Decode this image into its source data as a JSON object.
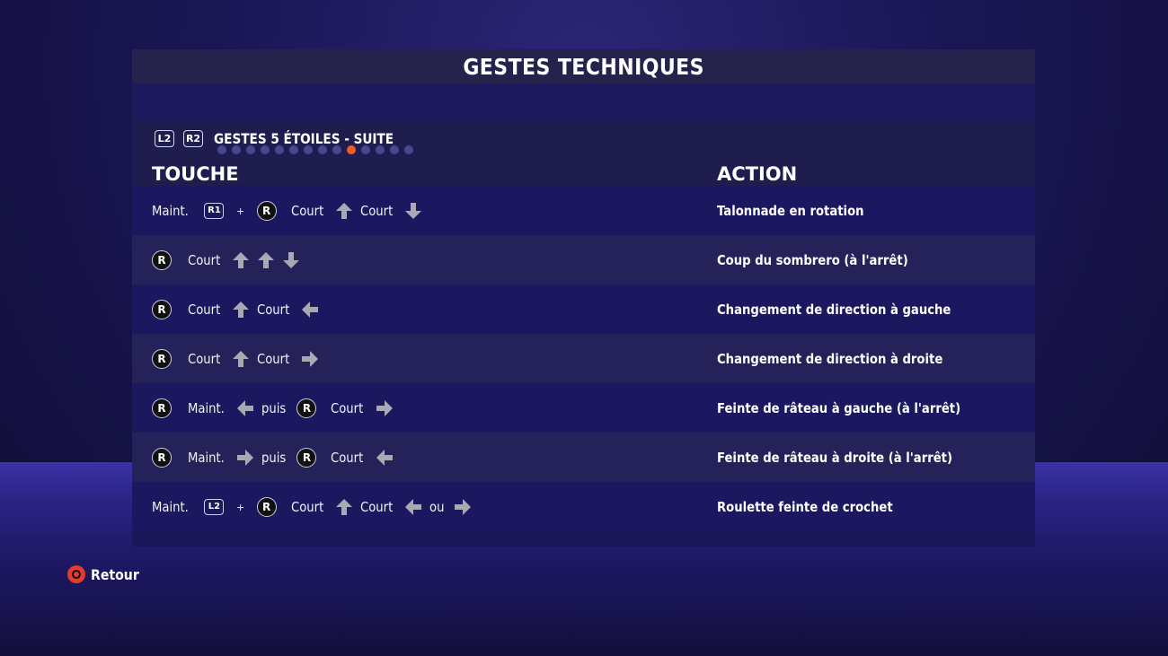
{
  "screen": {
    "title": "GESTES TECHNIQUES",
    "category": {
      "left_button": "L2",
      "right_button": "R2",
      "title": "GESTES 5 ÉTOILES - SUITE",
      "page_count": 14,
      "active_page": 10
    },
    "columns": {
      "touche": "TOUCHE",
      "action": "ACTION"
    },
    "rows": [
      {
        "sequence": [
          {
            "t": "word",
            "v": "Maint."
          },
          {
            "t": "key",
            "v": "R1"
          },
          {
            "t": "plus",
            "v": "+"
          },
          {
            "t": "stick",
            "v": "R"
          },
          {
            "t": "word",
            "v": "Court"
          },
          {
            "t": "arrow",
            "v": "up"
          },
          {
            "t": "word",
            "v": "Court"
          },
          {
            "t": "arrow",
            "v": "down"
          }
        ],
        "action": "Talonnade en rotation"
      },
      {
        "sequence": [
          {
            "t": "stick",
            "v": "R"
          },
          {
            "t": "word",
            "v": "Court"
          },
          {
            "t": "arrow",
            "v": "up"
          },
          {
            "t": "arrow",
            "v": "up"
          },
          {
            "t": "arrow",
            "v": "down"
          }
        ],
        "action": "Coup du sombrero (à l'arrêt)"
      },
      {
        "sequence": [
          {
            "t": "stick",
            "v": "R"
          },
          {
            "t": "word",
            "v": "Court"
          },
          {
            "t": "arrow",
            "v": "up"
          },
          {
            "t": "word",
            "v": "Court"
          },
          {
            "t": "arrow",
            "v": "left"
          }
        ],
        "action": "Changement de direction à gauche"
      },
      {
        "sequence": [
          {
            "t": "stick",
            "v": "R"
          },
          {
            "t": "word",
            "v": "Court"
          },
          {
            "t": "arrow",
            "v": "up"
          },
          {
            "t": "word",
            "v": "Court"
          },
          {
            "t": "arrow",
            "v": "right"
          }
        ],
        "action": "Changement de direction à droite"
      },
      {
        "sequence": [
          {
            "t": "stick",
            "v": "R"
          },
          {
            "t": "word",
            "v": "Maint."
          },
          {
            "t": "arrow",
            "v": "left"
          },
          {
            "t": "word",
            "v": "puis"
          },
          {
            "t": "stick",
            "v": "R"
          },
          {
            "t": "word",
            "v": "Court"
          },
          {
            "t": "arrow",
            "v": "right"
          }
        ],
        "action": "Feinte de râteau à gauche (à l'arrêt)"
      },
      {
        "sequence": [
          {
            "t": "stick",
            "v": "R"
          },
          {
            "t": "word",
            "v": "Maint."
          },
          {
            "t": "arrow",
            "v": "right"
          },
          {
            "t": "word",
            "v": "puis"
          },
          {
            "t": "stick",
            "v": "R"
          },
          {
            "t": "word",
            "v": "Court"
          },
          {
            "t": "arrow",
            "v": "left"
          }
        ],
        "action": "Feinte de râteau à droite (à l'arrêt)"
      },
      {
        "sequence": [
          {
            "t": "word",
            "v": "Maint."
          },
          {
            "t": "key",
            "v": "L2"
          },
          {
            "t": "plus",
            "v": "+"
          },
          {
            "t": "stick",
            "v": "R"
          },
          {
            "t": "word",
            "v": "Court"
          },
          {
            "t": "arrow",
            "v": "up"
          },
          {
            "t": "word",
            "v": "Court"
          },
          {
            "t": "arrow",
            "v": "left"
          },
          {
            "t": "word",
            "v": "ou"
          },
          {
            "t": "arrow",
            "v": "right"
          }
        ],
        "action": "Roulette feinte de crochet"
      }
    ],
    "footer": {
      "back_label": "Retour",
      "back_icon": "circle-button-icon"
    },
    "colors": {
      "accent": "#f35a2b",
      "panel": "#1a1758",
      "arrow": "#a9a9b4"
    }
  }
}
